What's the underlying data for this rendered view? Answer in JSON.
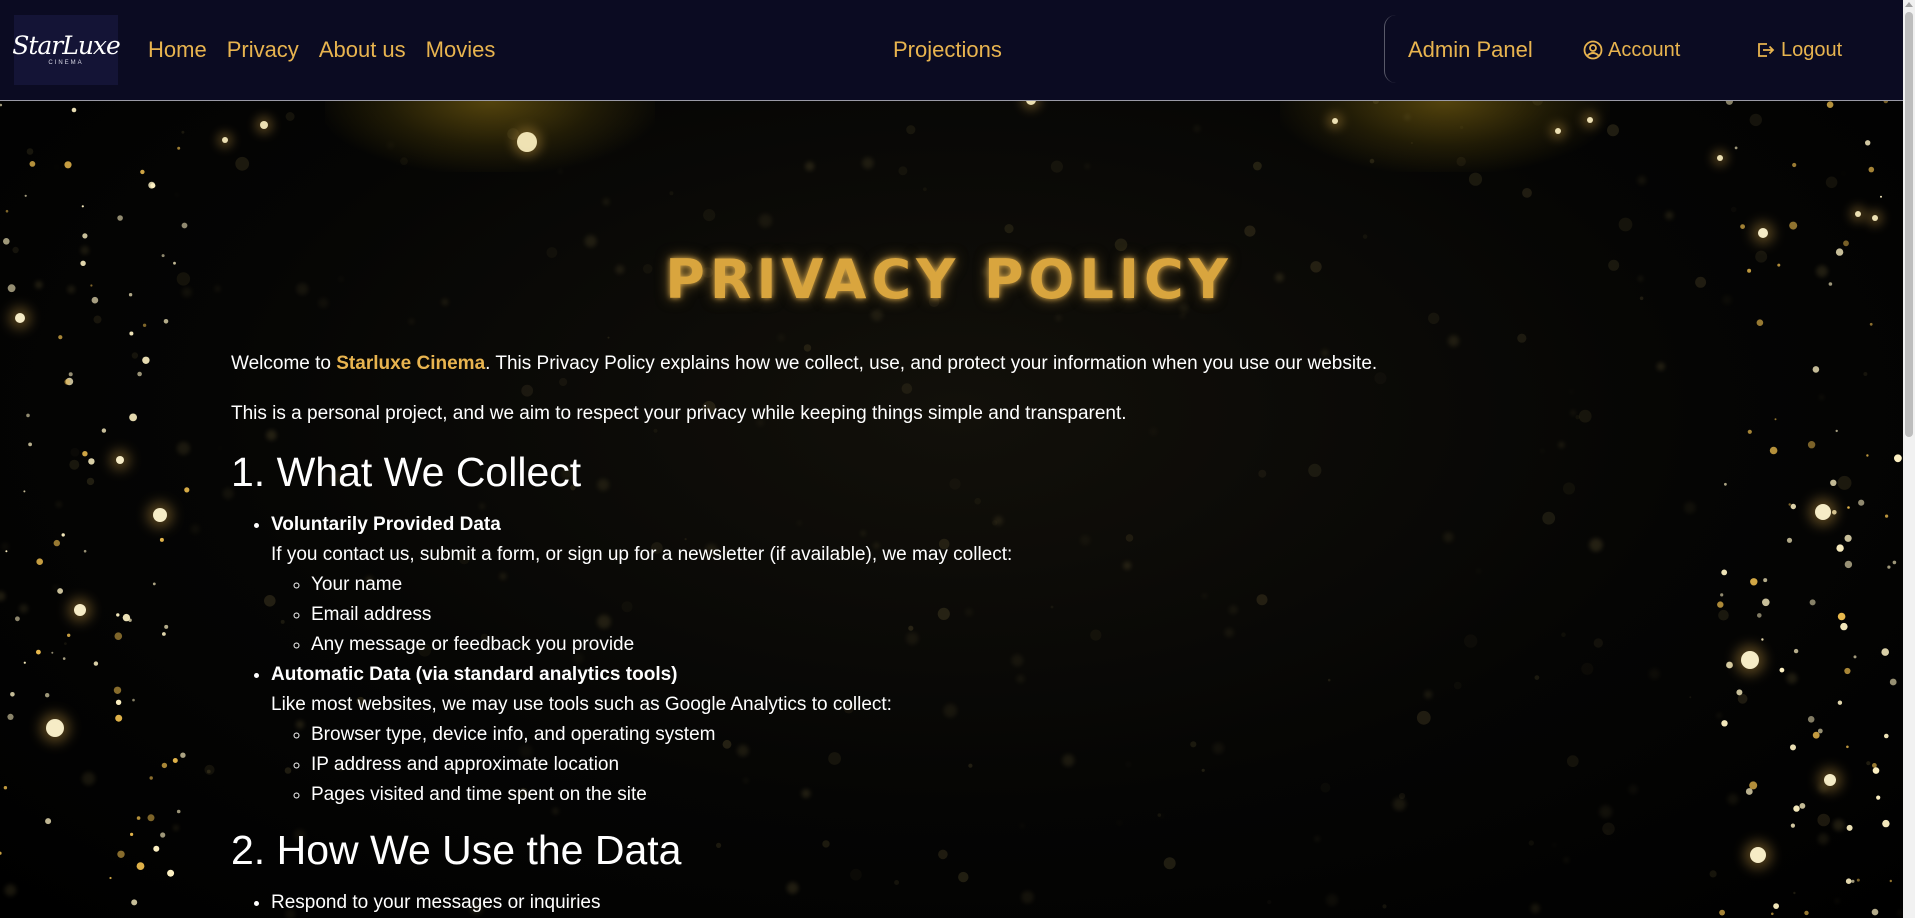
{
  "colors": {
    "accent": "#e8b44f",
    "navbar_bg": "#0b0b22",
    "page_bg": "#000000",
    "text": "#ffffff"
  },
  "navbar": {
    "logo": {
      "main": "StarLuxe",
      "sub": "CINEMA"
    },
    "links": [
      "Home",
      "Privacy",
      "About us",
      "Movies"
    ],
    "center_link": "Projections",
    "admin_label": "Admin Panel",
    "account": {
      "label": "Account",
      "icon": "user-circle-icon"
    },
    "logout": {
      "label": "Logout",
      "icon": "logout-icon"
    }
  },
  "page": {
    "title": "PRIVACY POLICY",
    "intro": {
      "prefix": "Welcome to ",
      "brand": "Starluxe Cinema",
      "suffix": ". This Privacy Policy explains how we collect, use, and protect your information when you use our website."
    },
    "intro2": "This is a personal project, and we aim to respect your privacy while keeping things simple and transparent.",
    "sections": [
      {
        "heading": "1. What We Collect",
        "items": [
          {
            "title": "Voluntarily Provided Data",
            "desc": "If you contact us, submit a form, or sign up for a newsletter (if available), we may collect:",
            "sub": [
              "Your name",
              "Email address",
              "Any message or feedback you provide"
            ]
          },
          {
            "title": "Automatic Data (via standard analytics tools)",
            "desc": "Like most websites, we may use tools such as Google Analytics to collect:",
            "sub": [
              "Browser type, device info, and operating system",
              "IP address and approximate location",
              "Pages visited and time spent on the site"
            ]
          }
        ]
      },
      {
        "heading": "2. How We Use the Data",
        "items": [
          {
            "text": "Respond to your messages or inquiries"
          }
        ]
      }
    ]
  }
}
